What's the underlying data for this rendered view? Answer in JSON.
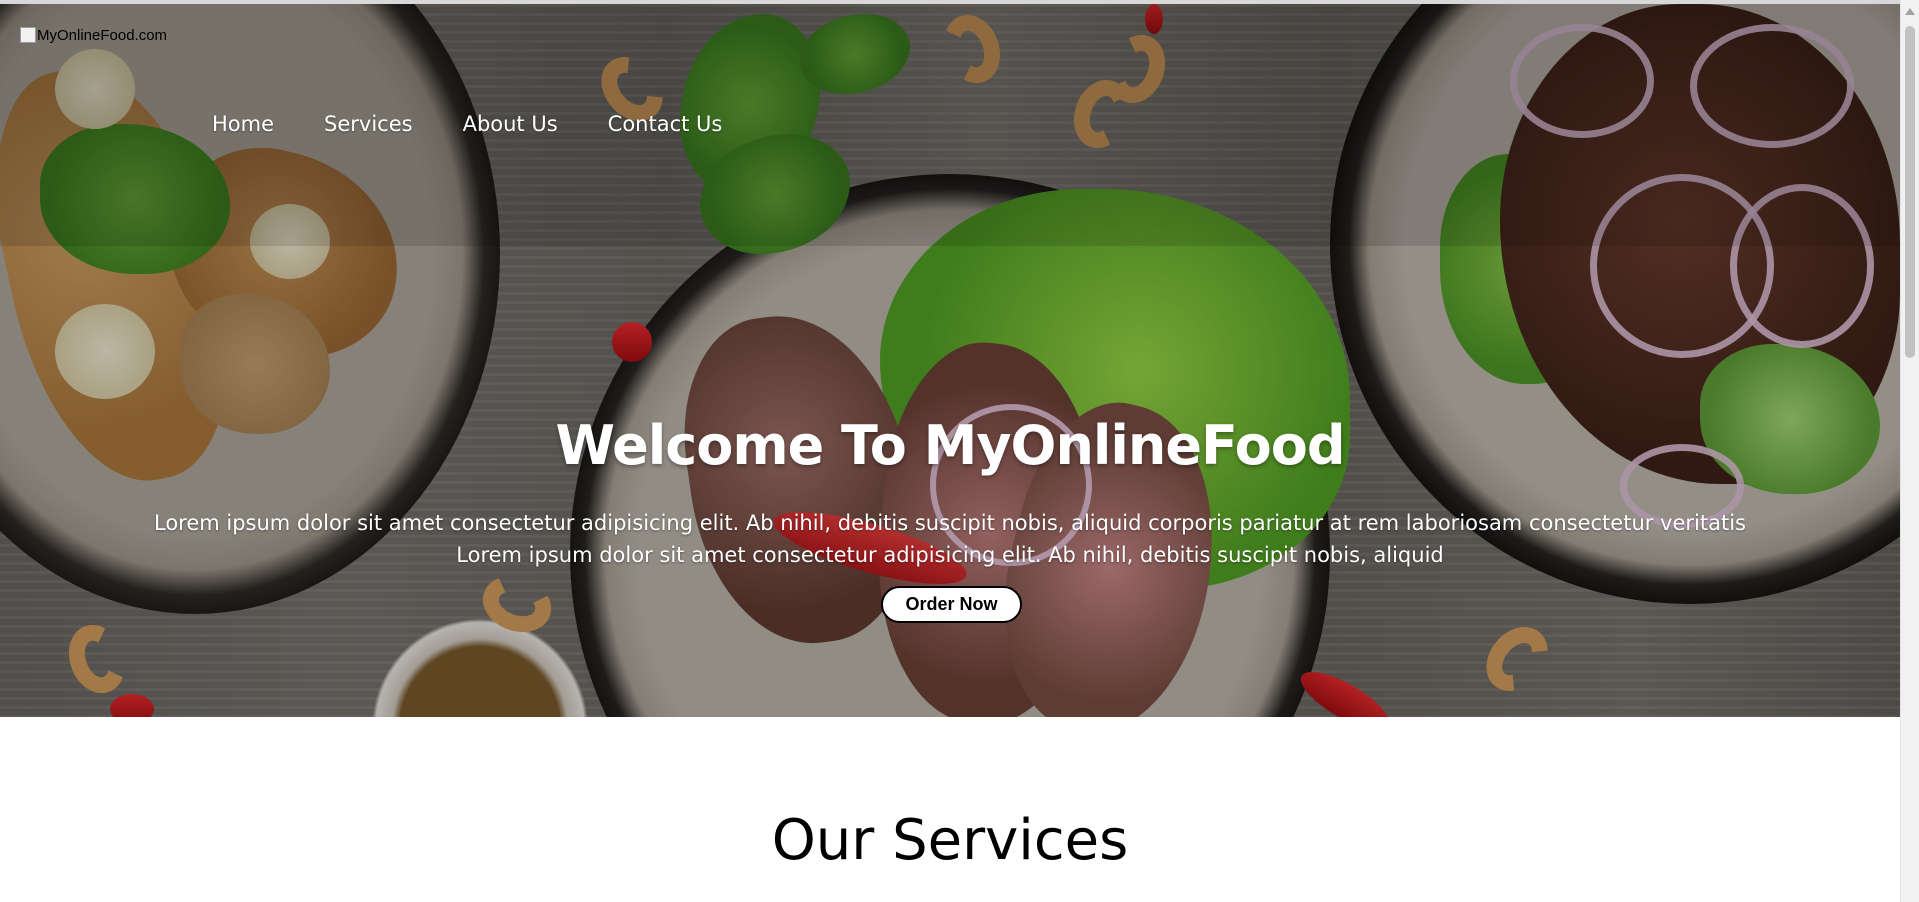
{
  "logo": {
    "alt_text": "MyOnlineFood.com"
  },
  "nav": {
    "items": [
      {
        "label": "Home"
      },
      {
        "label": "Services"
      },
      {
        "label": "About Us"
      },
      {
        "label": "Contact Us"
      }
    ]
  },
  "hero": {
    "title": "Welcome To MyOnlineFood",
    "paragraph_line1": "Lorem ipsum dolor sit amet consectetur adipisicing elit. Ab nihil, debitis suscipit nobis, aliquid corporis pariatur at rem laboriosam consectetur veritatis",
    "paragraph_line2": "Lorem ipsum dolor sit amet consectetur adipisicing elit. Ab nihil, debitis suscipit nobis, aliquid",
    "cta_label": "Order Now"
  },
  "services": {
    "heading": "Our Services"
  },
  "colors": {
    "hero_text": "#ffffff",
    "button_bg": "#ffffff",
    "button_border": "#000000",
    "page_bg": "#ffffff"
  }
}
